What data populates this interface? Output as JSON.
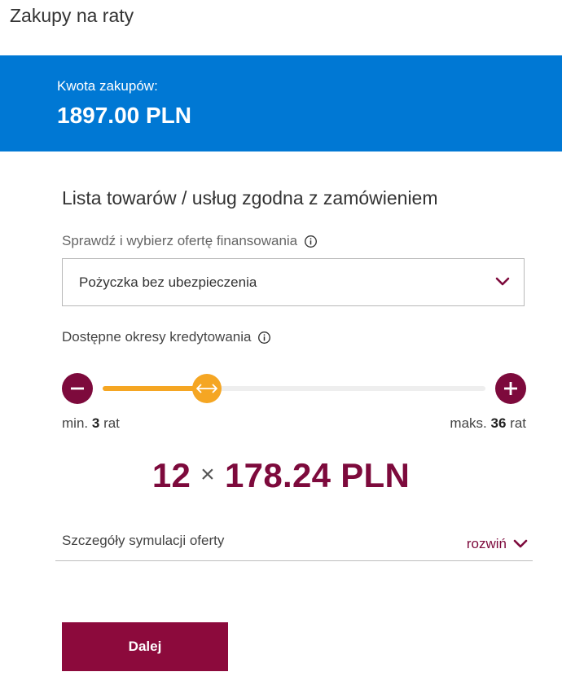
{
  "header": {
    "title": "Zakupy na raty"
  },
  "amount": {
    "label": "Kwota zakupów:",
    "value": "1897.00 PLN"
  },
  "section": {
    "title": "Lista towarów / usług zgodna z zamówieniem"
  },
  "offer": {
    "label": "Sprawdź i wybierz ofertę finansowania",
    "selected": "Pożyczka bez ubezpieczenia"
  },
  "periods": {
    "label": "Dostępne okresy kredytowania",
    "min_prefix": "min.",
    "min_value": "3",
    "min_suffix": "rat",
    "max_prefix": "maks.",
    "max_value": "36",
    "max_suffix": "rat",
    "slider_fraction": 0.273
  },
  "installment": {
    "count": "12",
    "times": "×",
    "amount": "178.24 PLN"
  },
  "details": {
    "label": "Szczegóły symulacji oferty",
    "toggle": "rozwiń"
  },
  "actions": {
    "next": "Dalej"
  },
  "colors": {
    "brand_blue": "#0078d4",
    "accent": "#7d0a3c",
    "slider": "#f5a623"
  },
  "icons": [
    "info-icon",
    "chevron-down-icon",
    "minus-icon",
    "plus-icon",
    "arrows-horizontal-icon"
  ]
}
